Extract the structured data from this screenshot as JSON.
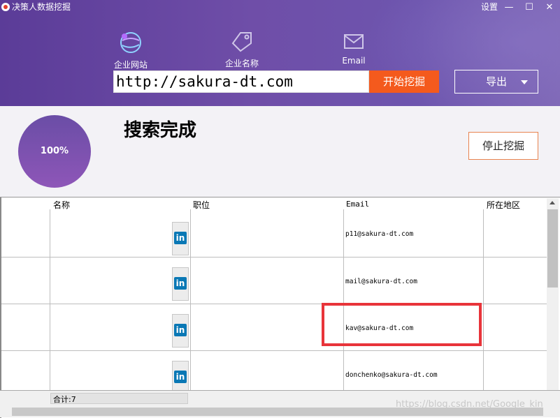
{
  "titlebar": {
    "title": "决策人数据挖掘",
    "settings_label": "设置",
    "minimize_icon": "—",
    "maximize_icon": "☐",
    "close_icon": "✕"
  },
  "nav": {
    "items": [
      {
        "label": "企业网站",
        "icon": "globe-icon"
      },
      {
        "label": "企业名称",
        "icon": "tag-icon"
      },
      {
        "label": "Email",
        "icon": "mail-icon"
      }
    ]
  },
  "search": {
    "url_value": "http://sakura-dt.com",
    "start_label": "开始挖掘",
    "export_label": "导出"
  },
  "status": {
    "progress_percent": 100,
    "progress_label": "100%",
    "message": "搜索完成",
    "stop_label": "停止挖掘"
  },
  "table": {
    "columns": [
      "名称",
      "职位",
      "Email",
      "所在地区"
    ],
    "rows": [
      {
        "name": "",
        "linkedin": "in",
        "title": "",
        "email": "p11@sakura-dt.com",
        "region": ""
      },
      {
        "name": "",
        "linkedin": "in",
        "title": "",
        "email": "mail@sakura-dt.com",
        "region": ""
      },
      {
        "name": "",
        "linkedin": "in",
        "title": "",
        "email": "kav@sakura-dt.com",
        "region": ""
      },
      {
        "name": "",
        "linkedin": "in",
        "title": "",
        "email": "donchenko@sakura-dt.com",
        "region": ""
      }
    ],
    "total_label": "合计:7"
  },
  "watermark": "https://blog.csdn.net/Google_kin",
  "colors": {
    "header": "#5b3c98",
    "accent": "#f45a1d",
    "linkedin": "#0a78b5",
    "highlight": "#e8343a"
  }
}
